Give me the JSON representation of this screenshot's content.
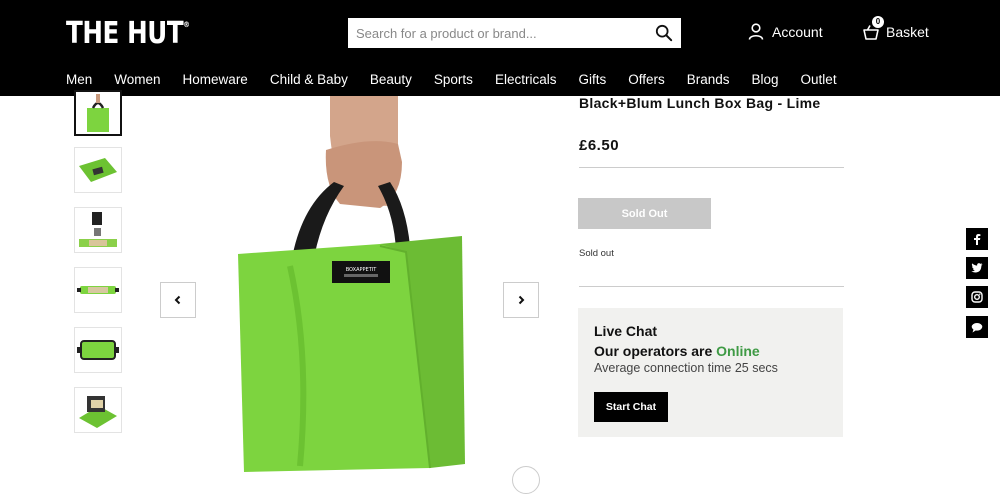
{
  "header": {
    "logo": "THE HUT",
    "logo_mark": "®",
    "search_placeholder": "Search for a product or brand...",
    "account_label": "Account",
    "basket_label": "Basket",
    "basket_count": "0"
  },
  "nav": [
    "Men",
    "Women",
    "Homeware",
    "Child & Baby",
    "Beauty",
    "Sports",
    "Electricals",
    "Gifts",
    "Offers",
    "Brands",
    "Blog",
    "Outlet"
  ],
  "product": {
    "title": "Black+Blum Lunch Box Bag - Lime",
    "price": "£6.50",
    "sold_out_button": "Sold Out",
    "stock_status": "Sold out",
    "bag_tag": "BOXAPPETIT"
  },
  "live_chat": {
    "title": "Live Chat",
    "operators_prefix": "Our operators are ",
    "operators_status": "Online",
    "connection_time": "Average connection time 25 secs",
    "button": "Start Chat"
  },
  "colors": {
    "header_bg": "#000000",
    "bag_green": "#7dd43f",
    "online_green": "#3e9a44",
    "sold_out_grey": "#c8c8c8",
    "chat_bg": "#f1f1ef"
  },
  "social": [
    "facebook-icon",
    "twitter-icon",
    "instagram-icon",
    "chat-icon"
  ]
}
